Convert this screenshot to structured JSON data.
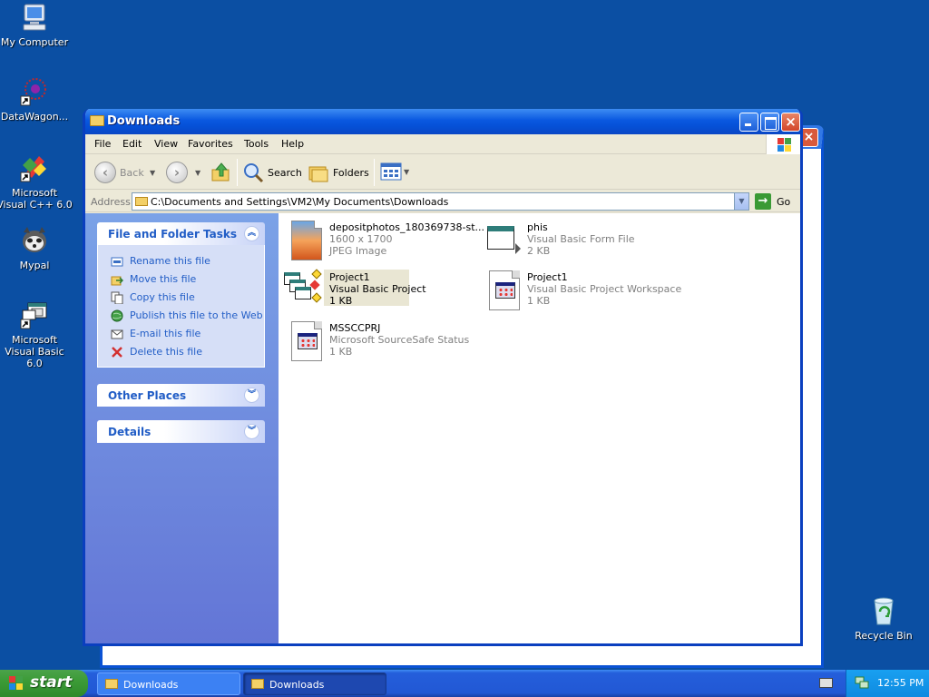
{
  "desktop": {
    "icons": [
      {
        "label": "My Computer",
        "icon": "computer-icon"
      },
      {
        "label": "DataWagon...",
        "icon": "datawagon-shortcut-icon"
      },
      {
        "label": "Microsoft Visual C++ 6.0",
        "icon": "visual-cpp-shortcut-icon"
      },
      {
        "label": "Mypal",
        "icon": "mypal-browser-icon"
      },
      {
        "label": "Microsoft Visual Basic 6.0",
        "icon": "visual-basic-shortcut-icon"
      },
      {
        "label": "Recycle Bin",
        "icon": "recycle-bin-icon"
      }
    ]
  },
  "window": {
    "title": "Downloads",
    "menu": [
      "File",
      "Edit",
      "View",
      "Favorites",
      "Tools",
      "Help"
    ],
    "toolbar": {
      "back_label": "Back",
      "search_label": "Search",
      "folders_label": "Folders"
    },
    "address": {
      "label": "Address",
      "path": "C:\\Documents and Settings\\VM2\\My Documents\\Downloads",
      "go_label": "Go"
    },
    "taskpane": {
      "file_tasks": {
        "title": "File and Folder Tasks",
        "items": [
          {
            "label": "Rename this file",
            "icon": "rename-icon"
          },
          {
            "label": "Move this file",
            "icon": "move-icon"
          },
          {
            "label": "Copy this file",
            "icon": "copy-icon"
          },
          {
            "label": "Publish this file to the Web",
            "icon": "publish-web-icon"
          },
          {
            "label": "E-mail this file",
            "icon": "email-icon"
          },
          {
            "label": "Delete this file",
            "icon": "delete-icon"
          }
        ]
      },
      "other_places": {
        "title": "Other Places"
      },
      "details": {
        "title": "Details"
      }
    },
    "files": [
      {
        "name": "depositphotos_180369738-st...",
        "line2": "1600 x 1700",
        "line3": "JPEG Image",
        "icon": "jpeg-image-icon",
        "selected": false
      },
      {
        "name": "phis",
        "line2": "Visual Basic Form File",
        "line3": "2 KB",
        "icon": "vb-form-icon",
        "selected": false
      },
      {
        "name": "Project1",
        "line2": "Visual Basic Project",
        "line3": "1 KB",
        "icon": "vb-project-icon",
        "selected": true
      },
      {
        "name": "Project1",
        "line2": "Visual Basic Project Workspace",
        "line3": "1 KB",
        "icon": "vb-workspace-icon",
        "selected": false
      },
      {
        "name": "MSSCCPRJ",
        "line2": "Microsoft SourceSafe Status",
        "line3": "1 KB",
        "icon": "sourcesafe-status-icon",
        "selected": false
      }
    ]
  },
  "taskbar": {
    "start_label": "start",
    "buttons": [
      {
        "label": "Downloads",
        "active": false
      },
      {
        "label": "Downloads",
        "active": true
      }
    ],
    "clock": "12:55 PM"
  },
  "colors": {
    "desktop": "#0b4fa3",
    "titlebar": "#0a58e0",
    "taskpane": "#6f8de0",
    "link": "#215dc6",
    "start_green": "#3c9b37"
  }
}
